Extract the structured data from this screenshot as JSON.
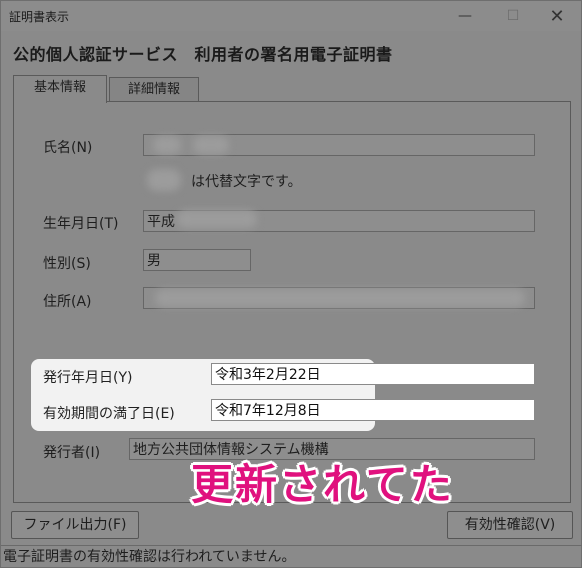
{
  "window": {
    "title": "証明書表示",
    "controls": {
      "minimize": "—",
      "maximize": "☐",
      "close": "✕"
    }
  },
  "header": {
    "title": "公的個人認証サービス　利用者の署名用電子証明書"
  },
  "tabs": [
    {
      "label": "基本情報",
      "active": true
    },
    {
      "label": "詳細情報",
      "active": false
    }
  ],
  "fields": {
    "name": {
      "label": "氏名(N)",
      "value": ""
    },
    "alt_char_note": "は代替文字です。",
    "birthdate": {
      "label": "生年月日(T)",
      "value": "平成"
    },
    "gender": {
      "label": "性別(S)",
      "value": "男"
    },
    "address": {
      "label": "住所(A)",
      "value": ""
    },
    "issue_date": {
      "label": "発行年月日(Y)",
      "value": "令和3年2月22日"
    },
    "expiry_date": {
      "label": "有効期間の満了日(E)",
      "value": "令和7年12月8日"
    },
    "issuer": {
      "label": "発行者(I)",
      "value": "地方公共団体情報システム機構"
    }
  },
  "overlay": {
    "text": "更新されてた",
    "color": "#e0117e"
  },
  "buttons": {
    "export": "ファイル出力(F)",
    "verify": "有効性確認(V)"
  },
  "status": "電子証明書の有効性確認は行われていません。"
}
